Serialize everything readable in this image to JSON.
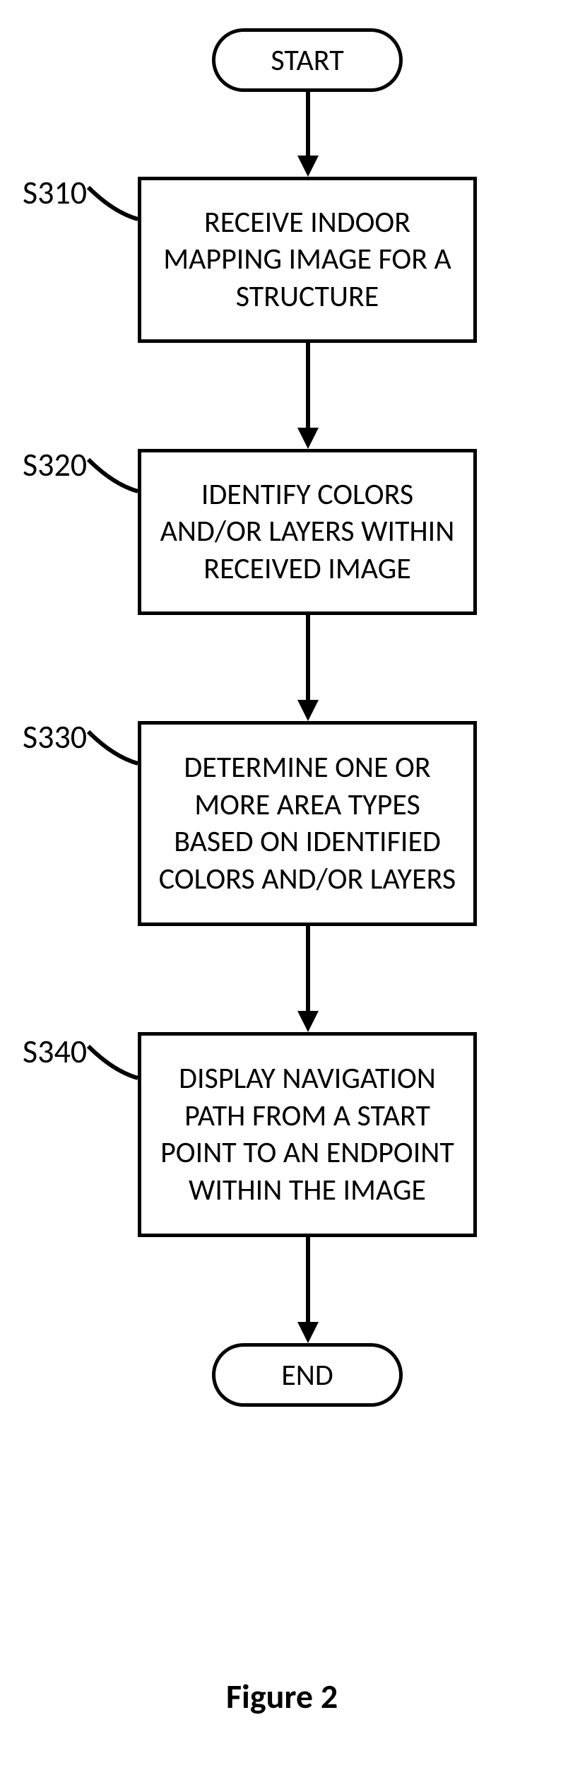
{
  "terminators": {
    "start": "START",
    "end": "END"
  },
  "steps": {
    "s310": {
      "label": "S310",
      "text": "RECEIVE INDOOR MAPPING IMAGE FOR A STRUCTURE"
    },
    "s320": {
      "label": "S320",
      "text": "IDENTIFY COLORS AND/OR LAYERS WITHIN RECEIVED IMAGE"
    },
    "s330": {
      "label": "S330",
      "text": "DETERMINE ONE OR MORE AREA TYPES BASED ON IDENTIFIED COLORS AND/OR LAYERS"
    },
    "s340": {
      "label": "S340",
      "text": "DISPLAY NAVIGATION PATH FROM A START POINT TO AN ENDPOINT WITHIN THE IMAGE"
    }
  },
  "caption": "Figure 2"
}
